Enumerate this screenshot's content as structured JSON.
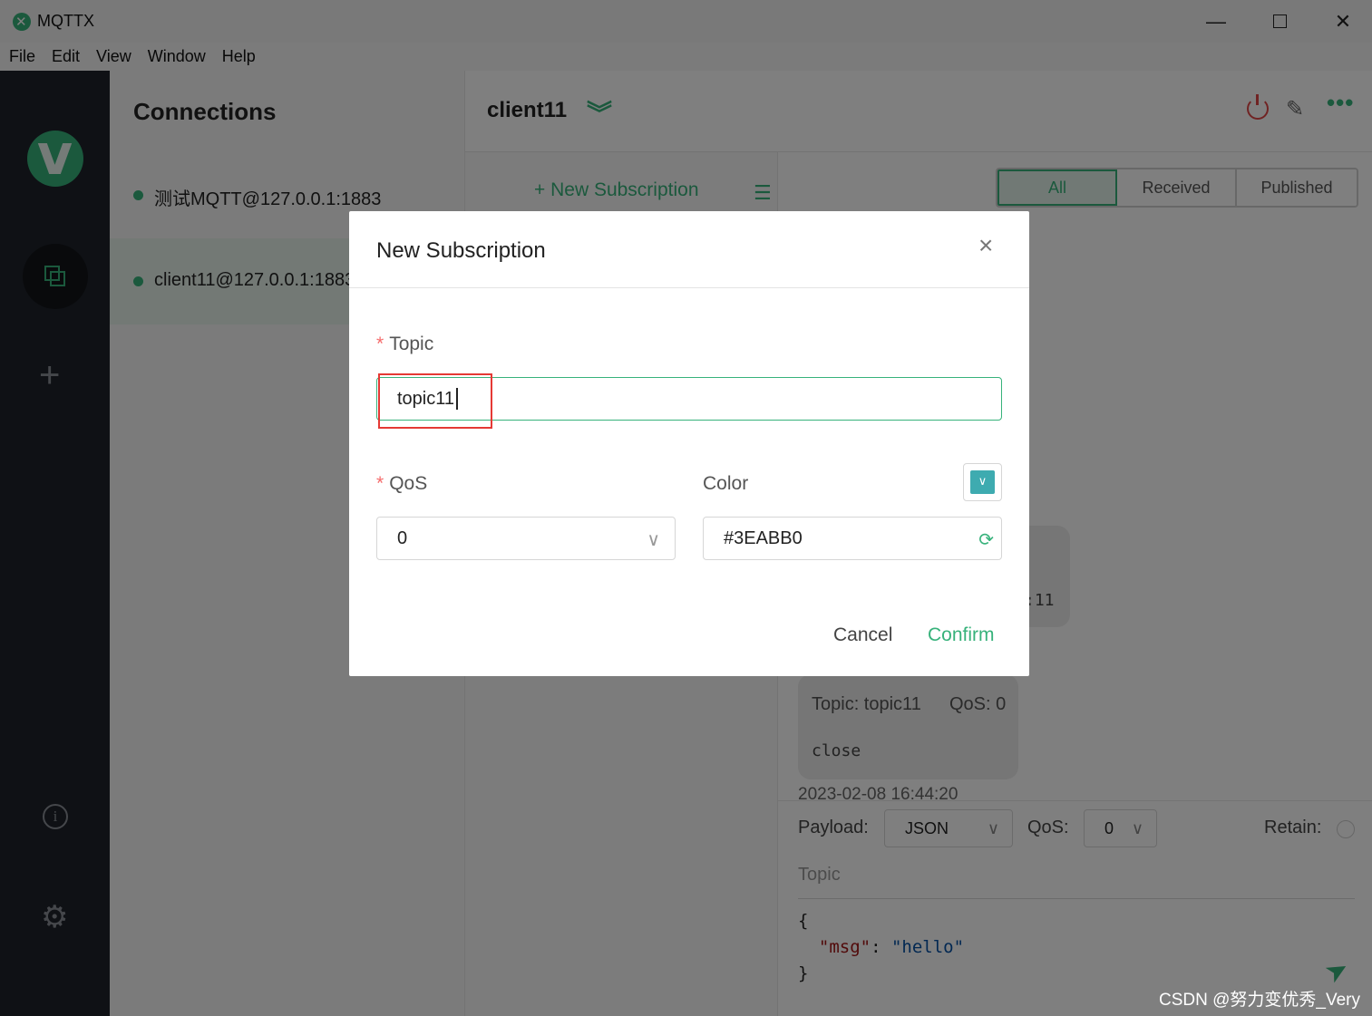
{
  "window": {
    "title": "MQTTX",
    "minimize_glyph": "—",
    "close_glyph": "✕"
  },
  "menu": [
    "File",
    "Edit",
    "View",
    "Window",
    "Help"
  ],
  "nav": {
    "icons": [
      "mqttx-logo-icon",
      "connections-icon",
      "plus-icon",
      "info-icon",
      "gear-icon"
    ]
  },
  "connections": {
    "title": "Connections",
    "items": [
      {
        "label": "测试MQTT@127.0.0.1:1883",
        "status": "connected"
      },
      {
        "label": "client11@127.0.0.1:1883",
        "status": "connected",
        "selected": true
      }
    ]
  },
  "main": {
    "client_name": "client11",
    "new_subscription_label": "+ New Subscription",
    "filters": [
      "All",
      "Received",
      "Published"
    ],
    "active_filter": "All",
    "messages": [
      {
        "partial_text": ":11"
      },
      {
        "topic": "Topic: topic11",
        "qos": "QoS: 0",
        "body": "close",
        "time": "2023-02-08 16:44:20"
      }
    ],
    "composer": {
      "payload_label": "Payload:",
      "payload_format": "JSON",
      "qos_label": "QoS:",
      "qos_value": "0",
      "retain_label": "Retain:",
      "topic_placeholder": "Topic",
      "code_open": "{",
      "code_key": "\"msg\"",
      "code_colon": ": ",
      "code_value": "\"hello\"",
      "code_close": "}"
    }
  },
  "dialog": {
    "title": "New Subscription",
    "topic_label": "Topic",
    "topic_value": "topic11",
    "qos_label": "QoS",
    "qos_value": "0",
    "color_label": "Color",
    "color_value": "#3EABB0",
    "cancel_label": "Cancel",
    "confirm_label": "Confirm",
    "required_mark": "*"
  },
  "colors": {
    "accent": "#37b27b",
    "danger": "#e04646",
    "nav_bg": "#1e232b",
    "subscription_color": "#3EABB0"
  },
  "watermark": "CSDN @努力变优秀_Very"
}
